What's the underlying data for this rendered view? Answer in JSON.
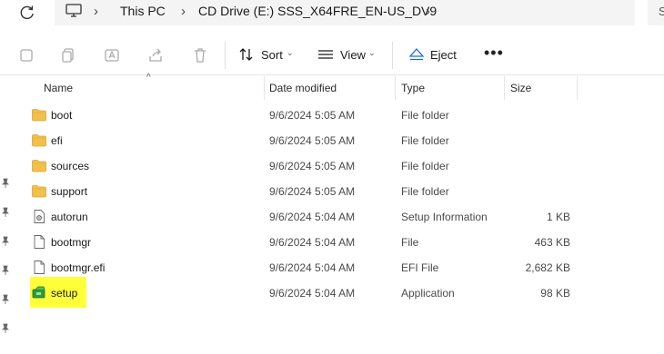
{
  "breadcrumb": {
    "segments": [
      "This PC",
      "CD Drive (E:) SSS_X64FRE_EN-US_DV9"
    ],
    "search_stub": "S"
  },
  "toolbar": {
    "sort_label": "Sort",
    "view_label": "View",
    "eject_label": "Eject",
    "more_label": "•••"
  },
  "columns": {
    "name": "Name",
    "date": "Date modified",
    "type": "Type",
    "size": "Size"
  },
  "files": [
    {
      "name": "boot",
      "date": "9/6/2024 5:05 AM",
      "type": "File folder",
      "size": "",
      "icon": "folder-icon"
    },
    {
      "name": "efi",
      "date": "9/6/2024 5:05 AM",
      "type": "File folder",
      "size": "",
      "icon": "folder-icon"
    },
    {
      "name": "sources",
      "date": "9/6/2024 5:05 AM",
      "type": "File folder",
      "size": "",
      "icon": "folder-icon"
    },
    {
      "name": "support",
      "date": "9/6/2024 5:05 AM",
      "type": "File folder",
      "size": "",
      "icon": "folder-icon"
    },
    {
      "name": "autorun",
      "date": "9/6/2024 5:04 AM",
      "type": "Setup Information",
      "size": "1 KB",
      "icon": "settings-file-icon"
    },
    {
      "name": "bootmgr",
      "date": "9/6/2024 5:04 AM",
      "type": "File",
      "size": "463 KB",
      "icon": "file-icon"
    },
    {
      "name": "bootmgr.efi",
      "date": "9/6/2024 5:04 AM",
      "type": "EFI File",
      "size": "2,682 KB",
      "icon": "file-icon"
    },
    {
      "name": "setup",
      "date": "9/6/2024 5:04 AM",
      "type": "Application",
      "size": "98 KB",
      "icon": "setup-app-icon"
    }
  ],
  "colors": {
    "folder": "#f2c04d",
    "highlight": "#ffff3a",
    "eject_accent": "#1f6fd1"
  }
}
